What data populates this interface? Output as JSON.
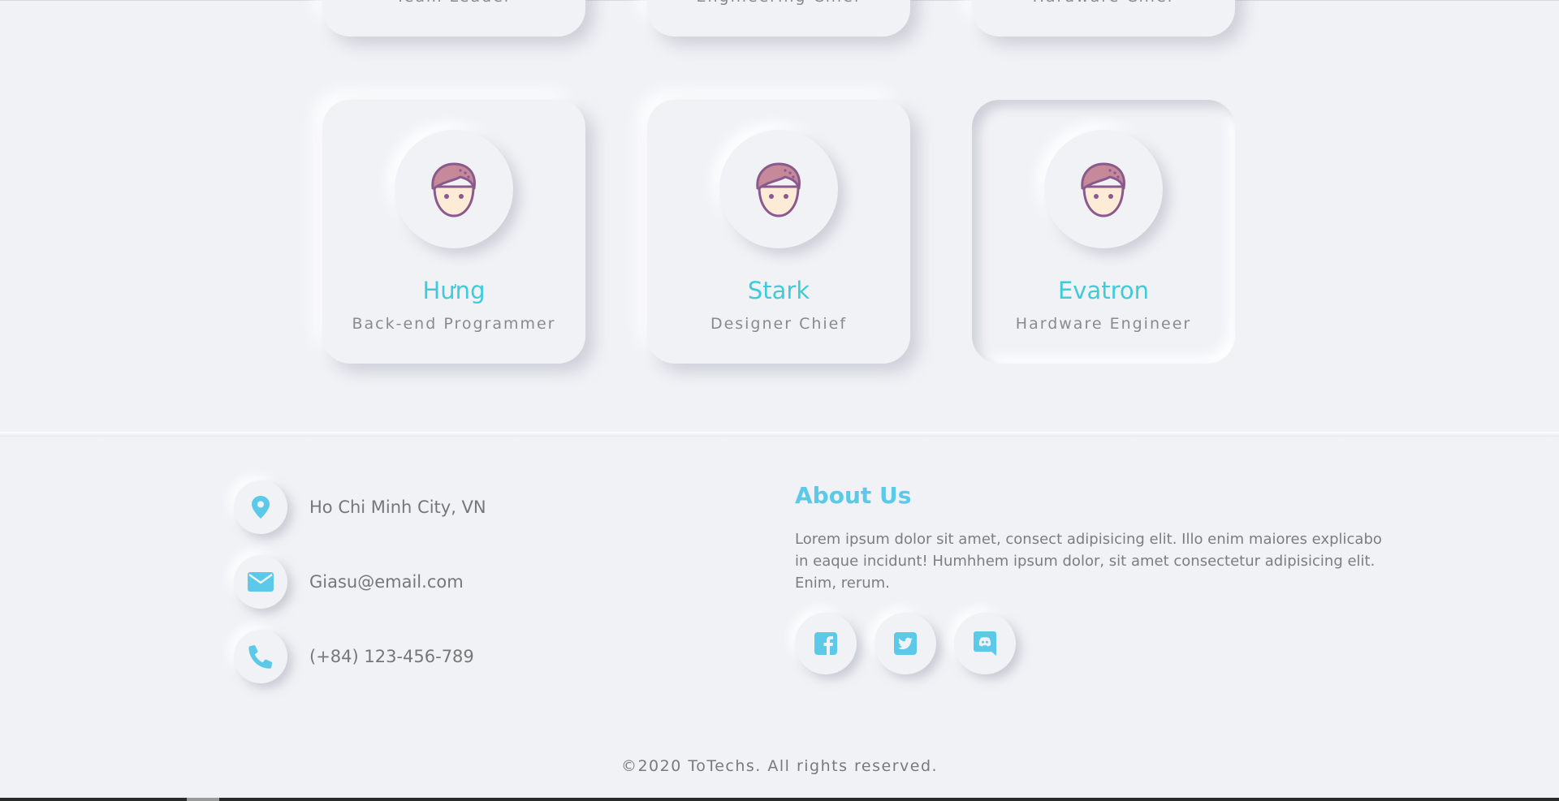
{
  "team": {
    "top_partial": [
      {
        "role": "Team Leader"
      },
      {
        "role": "Engineering Chief"
      },
      {
        "role": "Hardware Chief"
      }
    ],
    "members": [
      {
        "name": "Hưng",
        "role": "Back-end Programmer"
      },
      {
        "name": "Stark",
        "role": "Designer Chief"
      },
      {
        "name": "Evatron",
        "role": "Hardware Engineer"
      }
    ]
  },
  "footer": {
    "contact": {
      "address": "Ho Chi Minh City, VN",
      "email": "Giasu@email.com",
      "phone": "(+84) 123-456-789"
    },
    "about": {
      "title": "About Us",
      "text": "Lorem ipsum dolor sit amet, consect adipisicing elit. Illo enim maiores explicabo in eaque incidunt! Humhhem ipsum dolor, sit amet consectetur adipisicing elit. Enim, rerum."
    },
    "social": [
      "facebook-icon",
      "twitter-icon",
      "discord-icon"
    ],
    "copyright": "©2020 ToTechs. All rights reserved."
  },
  "colors": {
    "background": "#f1f2f6",
    "accent": "#3fcbd8",
    "icon_blue": "#5cc9e8"
  }
}
